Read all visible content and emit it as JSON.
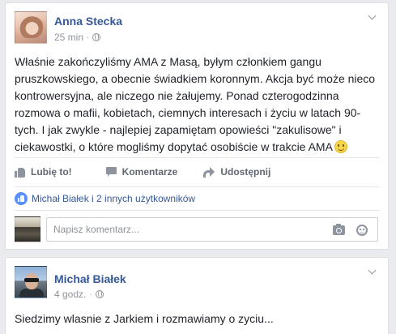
{
  "post1": {
    "author": "Anna Stecka",
    "time": "25 min",
    "separator": "·",
    "text": "Właśnie zakończyliśmy AMA z Masą, byłym członkiem gangu pruszkowskiego, a obecnie świadkiem koronnym. Akcja być może nieco kontrowersyjna, ale niczego nie żałujemy. Ponad czterogodzinna rozmowa o mafii, kobietach, ciemnych interesach i życiu w latach 90-tych. I jak zwykle - najlepiej zapamiętam opowieści \"zakulisowe\" i ciekawostki, o które mogliśmy dopytać osobiście w trakcie AMA",
    "actions": {
      "like": "Lubię to!",
      "comment": "Komentarze",
      "share": "Udostępnij"
    },
    "likes_summary": "Michał Białek i 2 innych użytkowników",
    "comment_placeholder": "Napisz komentarz..."
  },
  "post2": {
    "author": "Michał Białek",
    "time": "4 godz.",
    "separator": "·",
    "text": "Siedzimy wlasnie z Jarkiem i rozmawiamy o zyciu..."
  },
  "colors": {
    "link": "#365899",
    "meta": "#90949c",
    "text": "#1d2129",
    "background": "#e9ebee",
    "like_badge": "#5890ff"
  },
  "icons": [
    "globe-icon",
    "chevron-down-icon",
    "like-icon",
    "comment-icon",
    "share-icon",
    "like-badge-icon",
    "camera-icon",
    "sticker-icon",
    "emoji-smile-icon"
  ]
}
